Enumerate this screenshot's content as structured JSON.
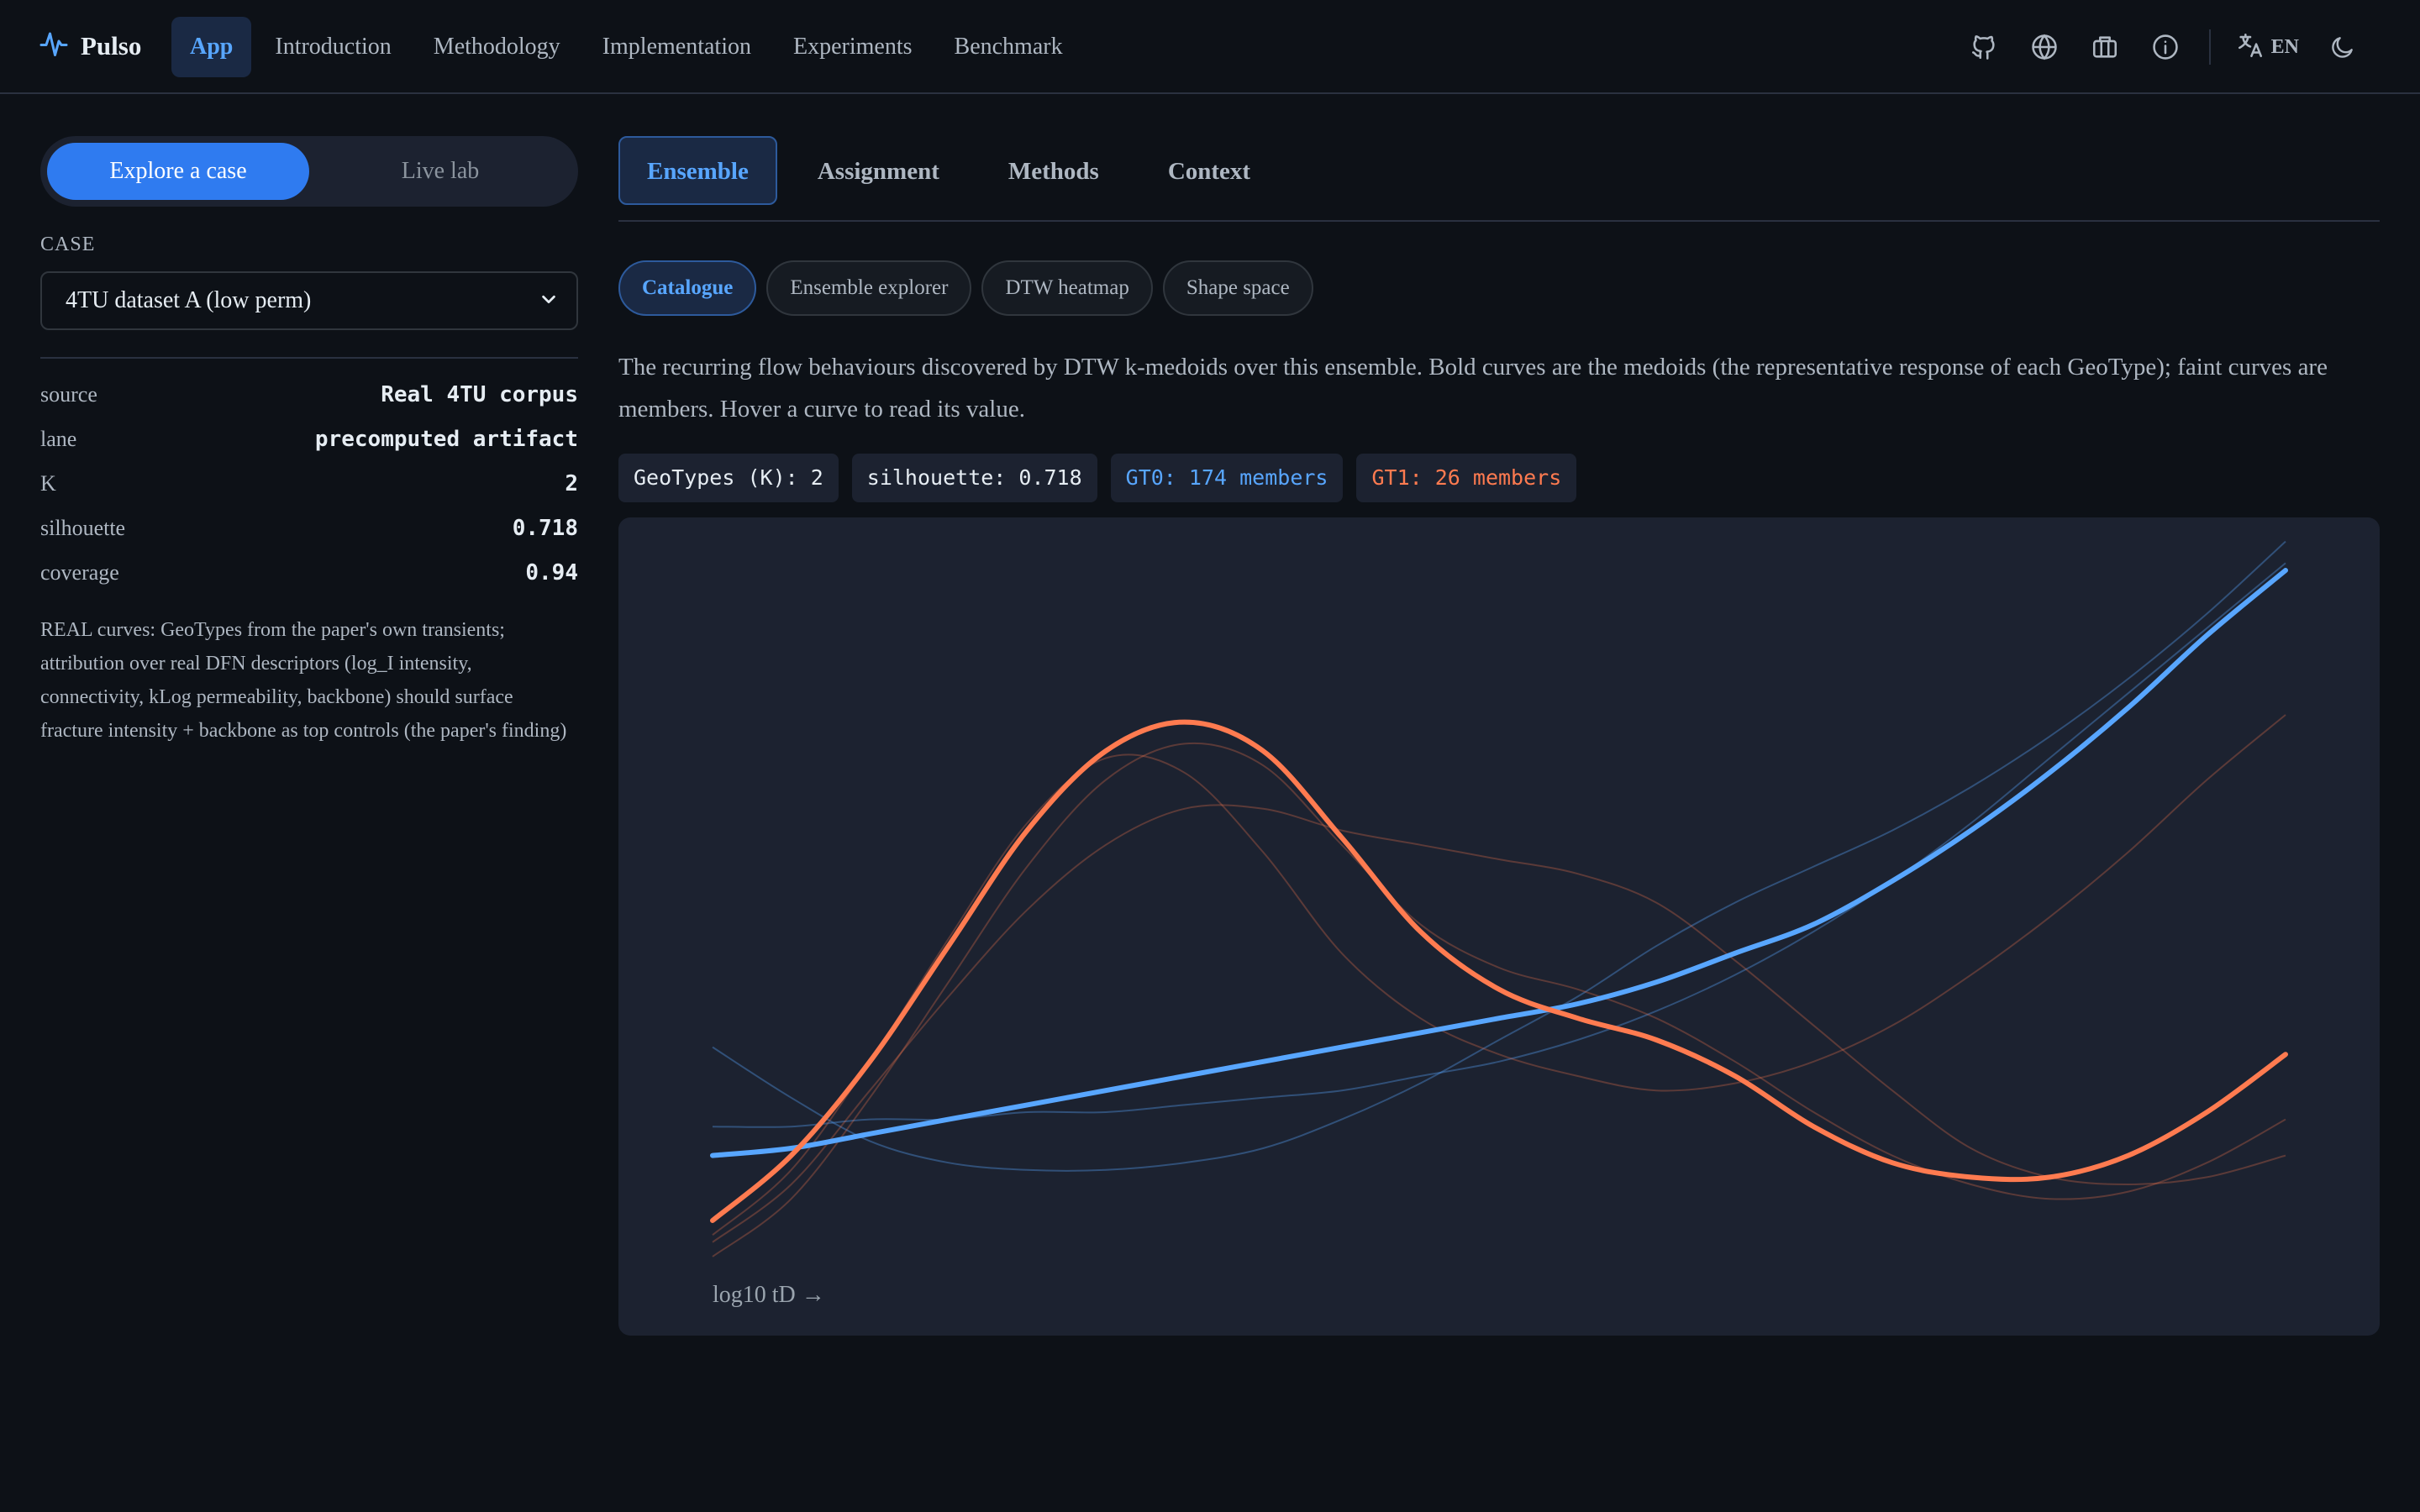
{
  "header": {
    "brand": "Pulso",
    "brand_icon": "pulse-icon",
    "nav": [
      {
        "label": "App",
        "active": true
      },
      {
        "label": "Introduction"
      },
      {
        "label": "Methodology"
      },
      {
        "label": "Implementation"
      },
      {
        "label": "Experiments"
      },
      {
        "label": "Benchmark"
      }
    ],
    "tools": [
      "github-icon",
      "globe-icon",
      "briefcase-icon",
      "info-icon"
    ],
    "language": {
      "icon": "translate-icon",
      "code": "EN"
    },
    "theme_icon": "moon-icon"
  },
  "sidebar": {
    "modes": [
      {
        "label": "Explore a case",
        "active": true
      },
      {
        "label": "Live lab"
      }
    ],
    "case_label": "CASE",
    "case_value": "4TU dataset A (low perm)",
    "stats": [
      {
        "key": "source",
        "value": "Real 4TU corpus"
      },
      {
        "key": "lane",
        "value": "precomputed artifact"
      },
      {
        "key": "K",
        "value": "2"
      },
      {
        "key": "silhouette",
        "value": "0.718"
      },
      {
        "key": "coverage",
        "value": "0.94"
      }
    ],
    "note": "REAL curves: GeoTypes from the paper's own transients; attribution over real DFN descriptors (log_I intensity, connectivity, kLog permeability, backbone) should surface fracture intensity + backbone as top controls (the paper's finding)"
  },
  "main": {
    "tabs": [
      {
        "label": "Ensemble",
        "active": true
      },
      {
        "label": "Assignment"
      },
      {
        "label": "Methods"
      },
      {
        "label": "Context"
      }
    ],
    "subtabs": [
      {
        "label": "Catalogue",
        "active": true
      },
      {
        "label": "Ensemble explorer"
      },
      {
        "label": "DTW heatmap"
      },
      {
        "label": "Shape space"
      }
    ],
    "description": "The recurring flow behaviours discovered by DTW k-medoids over this ensemble. Bold curves are the medoids (the representative response of each GeoType); faint curves are members. Hover a curve to read its value.",
    "badges": {
      "k": "GeoTypes (K): 2",
      "silhouette": "silhouette: 0.718",
      "gt0": "GT0: 174 members",
      "gt1": "GT1: 26 members"
    }
  },
  "colors": {
    "accent": "#58a6ff",
    "gt0": "#58a6ff",
    "gt1": "#ff7b50"
  },
  "chart_data": {
    "type": "line",
    "xlabel": "log10 tD →",
    "ylabel": "",
    "x": [
      0,
      0.5,
      1,
      1.5,
      2,
      2.5,
      3,
      3.5,
      4,
      4.5,
      5,
      5.5,
      6,
      6.5,
      7,
      7.5,
      8,
      8.5,
      9,
      9.5,
      10
    ],
    "ylim": [
      0,
      1
    ],
    "series": [
      {
        "name": "GT0",
        "role": "medoid",
        "color": "#58a6ff",
        "values": [
          0.14,
          0.15,
          0.17,
          0.19,
          0.21,
          0.23,
          0.25,
          0.27,
          0.29,
          0.31,
          0.33,
          0.35,
          0.38,
          0.42,
          0.46,
          0.52,
          0.59,
          0.67,
          0.76,
          0.86,
          0.95
        ]
      },
      {
        "name": "GT1",
        "role": "medoid",
        "color": "#ff7b50",
        "values": [
          0.05,
          0.14,
          0.27,
          0.43,
          0.59,
          0.7,
          0.74,
          0.7,
          0.58,
          0.45,
          0.37,
          0.33,
          0.3,
          0.25,
          0.18,
          0.13,
          0.11,
          0.11,
          0.14,
          0.2,
          0.28
        ]
      },
      {
        "role": "member",
        "group": "GT0",
        "values": [
          0.29,
          0.22,
          0.16,
          0.13,
          0.12,
          0.12,
          0.13,
          0.15,
          0.19,
          0.24,
          0.3,
          0.36,
          0.43,
          0.49,
          0.54,
          0.59,
          0.65,
          0.72,
          0.8,
          0.89,
          0.99
        ]
      },
      {
        "role": "member",
        "group": "GT0",
        "values": [
          0.18,
          0.18,
          0.19,
          0.19,
          0.2,
          0.2,
          0.21,
          0.22,
          0.23,
          0.25,
          0.27,
          0.3,
          0.34,
          0.39,
          0.45,
          0.52,
          0.6,
          0.69,
          0.78,
          0.87,
          0.96
        ]
      },
      {
        "role": "member",
        "group": "GT1",
        "values": [
          0.0,
          0.08,
          0.22,
          0.38,
          0.54,
          0.66,
          0.71,
          0.68,
          0.57,
          0.46,
          0.4,
          0.37,
          0.33,
          0.27,
          0.2,
          0.14,
          0.1,
          0.08,
          0.09,
          0.13,
          0.19
        ]
      },
      {
        "role": "member",
        "group": "GT1",
        "values": [
          0.02,
          0.1,
          0.23,
          0.36,
          0.48,
          0.57,
          0.62,
          0.62,
          0.59,
          0.57,
          0.55,
          0.53,
          0.49,
          0.41,
          0.32,
          0.23,
          0.15,
          0.11,
          0.1,
          0.11,
          0.14
        ]
      },
      {
        "role": "member",
        "group": "GT1",
        "values": [
          0.03,
          0.12,
          0.27,
          0.44,
          0.6,
          0.69,
          0.67,
          0.56,
          0.42,
          0.33,
          0.28,
          0.25,
          0.23,
          0.24,
          0.27,
          0.32,
          0.39,
          0.47,
          0.56,
          0.66,
          0.75
        ]
      }
    ]
  }
}
